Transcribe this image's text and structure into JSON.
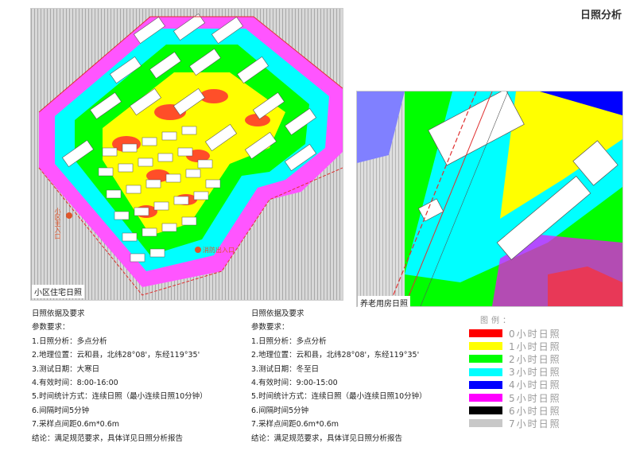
{
  "title": "日照分析",
  "maps": {
    "left_caption": "小区住宅日照",
    "left_entry_main": "小区主入口",
    "left_entry_fire": "消防出入口",
    "right_caption": "养老用房日照"
  },
  "left_text": {
    "heading": "日照依据及要求",
    "param_title": "参数要求：",
    "lines": [
      "1.日照分析：多点分析",
      "2.地理位置：云和县，北纬28°08'，东经119°35'",
      "3.测试日期：大寒日",
      "4.有效时间：8:00-16:00",
      "5.时间统计方式：连续日照（最小连续日照10分钟）",
      "6.间隔时间5分钟",
      "7.采样点间距0.6m*0.6m"
    ],
    "conclusion": "结论：满足规范要求，具体详见日照分析报告"
  },
  "right_text": {
    "heading": "日照依据及要求",
    "param_title": "参数要求：",
    "lines": [
      "1.日照分析：多点分析",
      "2.地理位置：云和县，北纬28°08'，东经119°35'",
      "3.测试日期：冬至日",
      "4.有效时间：9:00-15:00",
      "5.时间统计方式：连续日照（最小连续日照10分钟）",
      "6.间隔时间5分钟",
      "7.采样点间距0.6m*0.6m"
    ],
    "conclusion": "结论：满足规范要求，具体详见日照分析报告"
  },
  "legend": {
    "title": "图例：",
    "items": [
      {
        "label": "0小时日照",
        "color": "#ff0000"
      },
      {
        "label": "1小时日照",
        "color": "#ffff00"
      },
      {
        "label": "2小时日照",
        "color": "#00ff00"
      },
      {
        "label": "3小时日照",
        "color": "#00ffff"
      },
      {
        "label": "4小时日照",
        "color": "#0000ff"
      },
      {
        "label": "5小时日照",
        "color": "#ff00ff"
      },
      {
        "label": "6小时日照",
        "color": "#000000"
      },
      {
        "label": "7小时日照",
        "color": "#c8c8c8"
      }
    ]
  }
}
